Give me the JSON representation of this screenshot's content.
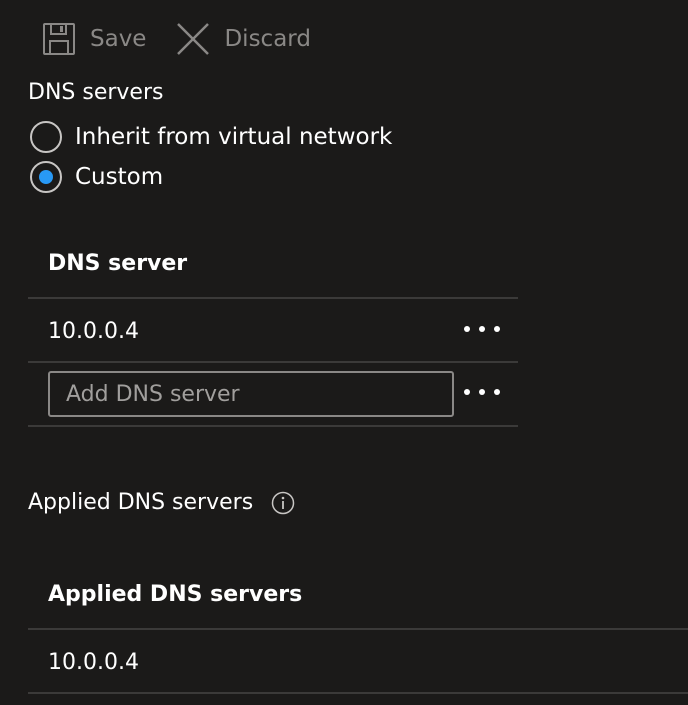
{
  "toolbar": {
    "save_label": "Save",
    "discard_label": "Discard"
  },
  "dns_servers": {
    "label": "DNS servers",
    "options": [
      {
        "label": "Inherit from virtual network",
        "checked": false
      },
      {
        "label": "Custom",
        "checked": true
      }
    ],
    "table_header": "DNS server",
    "rows": [
      {
        "value": "10.0.0.4"
      }
    ],
    "add_input": {
      "value": "",
      "placeholder": "Add DNS server"
    }
  },
  "applied": {
    "label": "Applied DNS servers",
    "info_icon": "info-icon",
    "table_header": "Applied DNS servers",
    "rows": [
      {
        "value": "10.0.0.4"
      }
    ]
  },
  "colors": {
    "background": "#1b1a19",
    "accent": "#2899f5",
    "divider": "#3b3a39",
    "disabled_text": "#8a8886"
  }
}
